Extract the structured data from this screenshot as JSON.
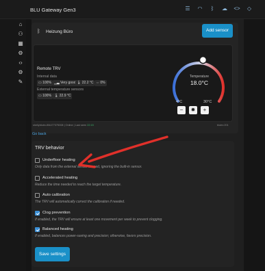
{
  "app": {
    "title": "BLU Gateway Gen3"
  },
  "topbar": {
    "icons": [
      "sliders-icon",
      "wifi-icon",
      "bluetooth-icon",
      "cloud-icon",
      "code-icon",
      "cube-icon"
    ]
  },
  "sidebar": {
    "items": [
      "home-icon",
      "devices-icon",
      "calendar-icon",
      "settings-icon",
      "code-icon",
      "network-icon",
      "wrench-icon"
    ]
  },
  "room": {
    "name": "Heizung Büro",
    "add_sensor": "Add sensor"
  },
  "trv": {
    "title": "Remote TRV",
    "internal_label": "Internal data",
    "internal_chips": [
      "100%",
      "Very good",
      "22.2 °C",
      "0%"
    ],
    "external_label": "External temperature sensors",
    "external_chips": [
      "100%",
      "22.9 °C"
    ],
    "dial": {
      "label": "Temperature",
      "value": "18.0°C",
      "min": "4°C",
      "max": "30°C",
      "setpoint": 18.0,
      "range": [
        4,
        30
      ]
    },
    "footer_id": "shellyblutrv-f84477375008 | Online | Last seen",
    "footer_time": "22:15",
    "footer_right": "blutrv:201"
  },
  "nav": {
    "go_back": "Go back"
  },
  "behavior": {
    "title": "TRV behavior",
    "options": [
      {
        "label": "Underfloor heating",
        "desc": "Only data from the external sensor is used, ignoring the built-in sensor.",
        "checked": false
      },
      {
        "label": "Accelerated heating",
        "desc": "Reduce the time needed to reach the target temperature.",
        "checked": false
      },
      {
        "label": "Auto calibration",
        "desc": "The TRV will automatically correct the calibration if needed.",
        "checked": false
      },
      {
        "label": "Clog prevention",
        "desc": "If enabled, the TRV will ensure at least one movement per week to prevent clogging.",
        "checked": true
      },
      {
        "label": "Balanced heating",
        "desc": "If enabled, balances power-saving and precision; otherwise, favors precision.",
        "checked": true
      }
    ],
    "save": "Save settings"
  },
  "colors": {
    "accent": "#1a90c8",
    "annotation": "#e0302a",
    "dial_cold": "#3a6fd8",
    "dial_hot": "#e0302a"
  }
}
